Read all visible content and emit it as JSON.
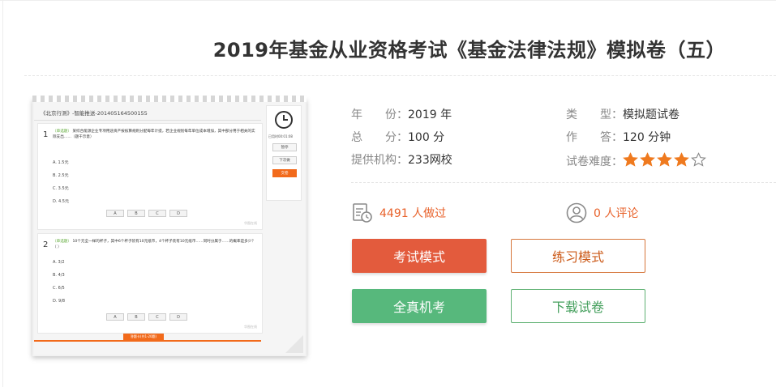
{
  "page": {
    "title": "2019年基金从业资格考试《基金法律法规》模拟卷（五）"
  },
  "preview": {
    "header": "《北京行测》-智能推送-201405164500155",
    "q1": {
      "num": "1",
      "tag": "（单选题）",
      "text": "某综合能源企业专项用途资产按核算规则分配每年计提，若企业规划每年单位成本增加，其中部分用于相关的实际支出……（题干示意）",
      "options": [
        "A. 1.5元",
        "B. 2.5元",
        "C. 3.5元",
        "D. 4.5元"
      ]
    },
    "q2": {
      "num": "2",
      "tag": "（单选题）",
      "text": "10个元全一样的杯子，其中6个杯子装有10元纸币，4个杯子装有10元纸币……同时分属于……的概率是多少？（   ）",
      "options": [
        "A. 3/2",
        "B. 4/3",
        "C. 6/5",
        "D. 9/8"
      ]
    },
    "answer_buttons": [
      "A",
      "B",
      "C",
      "D"
    ],
    "watermark": "华图在线",
    "timer": "已用时00:01:08",
    "side_buttons": [
      "暂停",
      "下次做",
      "交卷"
    ],
    "footer_button": "答题卡(共1-20题)"
  },
  "meta": {
    "year_label": "年　　份：",
    "year_value": "2019 年",
    "score_label": "总　　分：",
    "score_value": "100 分",
    "provider_label": "提供机构：",
    "provider_value": "233网校",
    "type_label": "类　　型：",
    "type_value": "模拟题试卷",
    "time_label": "作　　答：",
    "time_value": "120 分钟",
    "difficulty_label": "试卷难度：",
    "difficulty_stars_filled": 4,
    "difficulty_stars_total": 5
  },
  "stats": {
    "done_text": "4491 人做过",
    "comment_text": "0 人评论"
  },
  "buttons": {
    "exam_mode": "考试模式",
    "practice_mode": "练习模式",
    "simulation": "全真机考",
    "download": "下载试卷"
  },
  "colors": {
    "exam_button": "#e35b3d",
    "simulation_button": "#57b87c",
    "star": "#ef7a1f",
    "stat_text": "#e8622b"
  }
}
